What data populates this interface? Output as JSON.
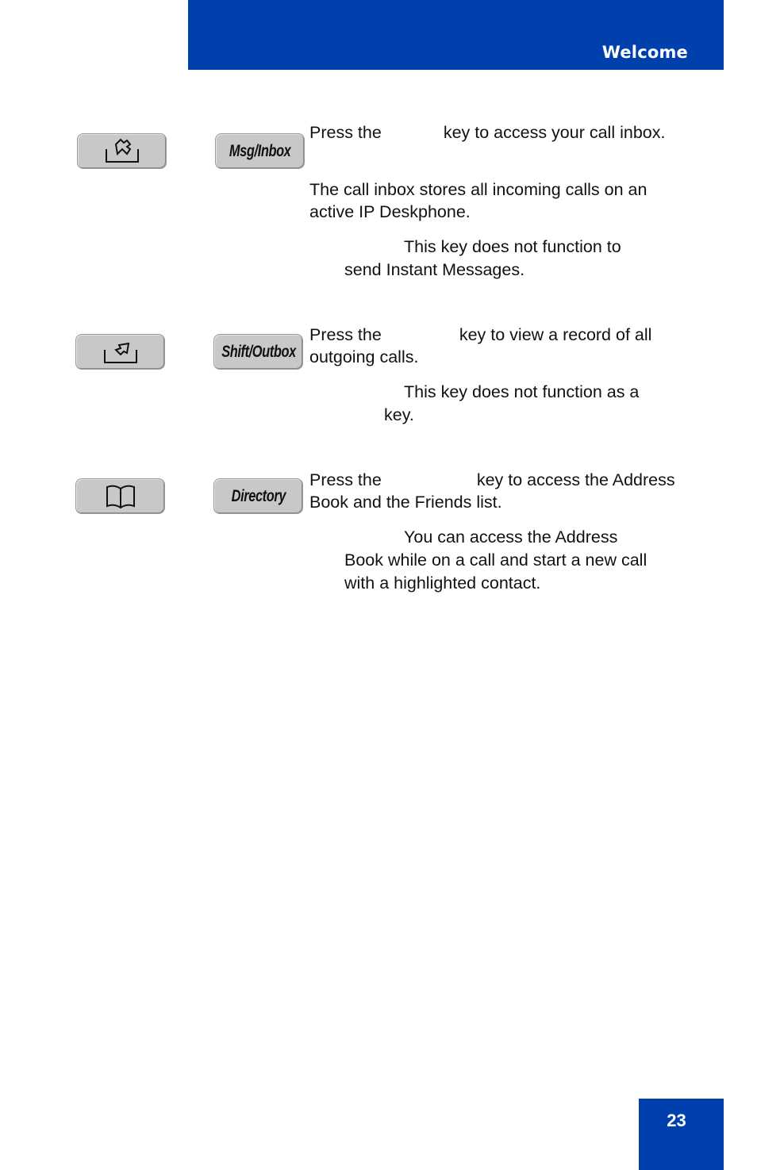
{
  "header": {
    "title": "Welcome"
  },
  "footer": {
    "page_number": "23"
  },
  "sections": [
    {
      "icon_key": "inbox-icon",
      "label_key": "Msg/Inbox",
      "paragraphs": [
        {
          "before": "Press the",
          "after": "key to access your call inbox."
        },
        {
          "text": "The call inbox stores all incoming calls on an active IP Deskphone."
        }
      ],
      "note": {
        "line1": "This key does not function to",
        "line2": "send Instant Messages."
      }
    },
    {
      "icon_key": "outbox-icon",
      "label_key": "Shift/Outbox",
      "paragraphs": [
        {
          "before": "Press the",
          "after": "key to view a record of all outgoing calls."
        }
      ],
      "note": {
        "line1": "This key does not function as a",
        "line2": "key."
      }
    },
    {
      "icon_key": "directory-book-icon",
      "label_key": "Directory",
      "paragraphs": [
        {
          "before": "Press the",
          "after": "key to access the Address Book and the Friends list."
        }
      ],
      "note": {
        "line1": "You can access the Address",
        "line2": "Book while on a call and start a new call",
        "line3": "with a highlighted contact."
      }
    }
  ]
}
